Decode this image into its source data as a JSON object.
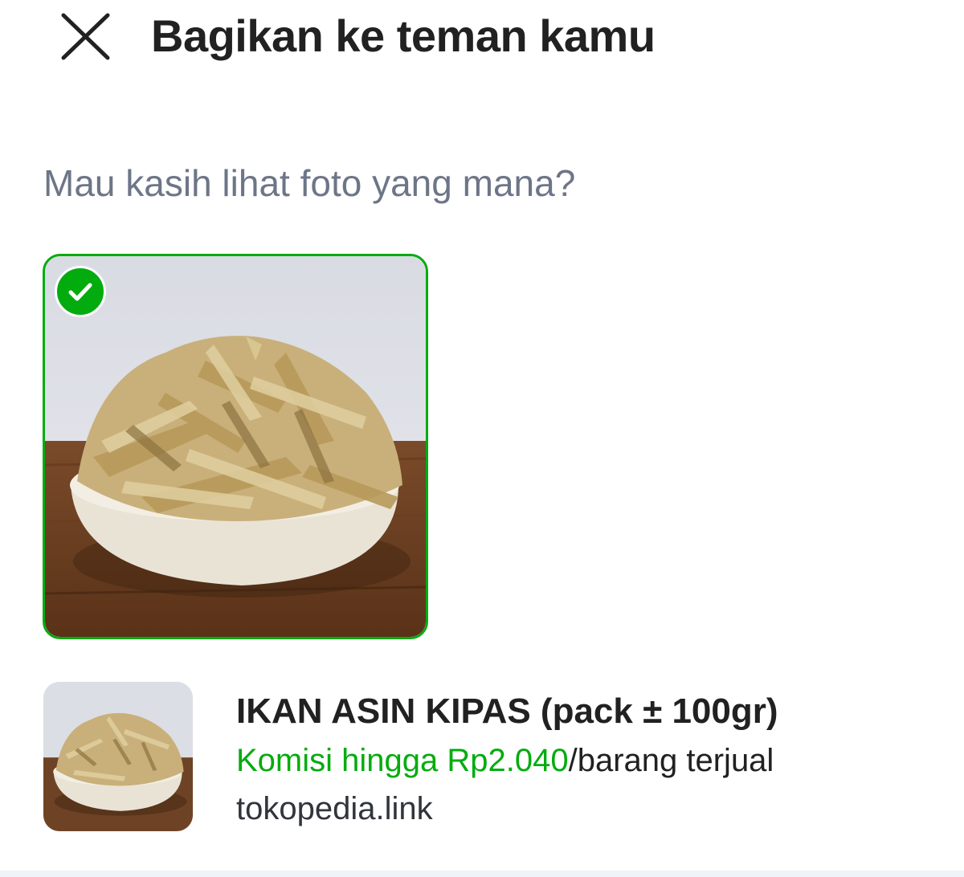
{
  "header": {
    "title": "Bagikan ke teman kamu",
    "close_icon": "close-icon"
  },
  "prompt": "Mau kasih lihat foto yang mana?",
  "photos": [
    {
      "selected": true,
      "check_icon": "check-icon",
      "selected_color": "#03ac0e"
    }
  ],
  "product": {
    "name": "IKAN ASIN KIPAS (pack ± 100gr)",
    "commission_highlight": "Komisi hingga Rp2.040",
    "commission_suffix": "/barang terjual",
    "link": "tokopedia.link"
  },
  "colors": {
    "accent": "#03ac0e",
    "text_primary": "#212121",
    "text_secondary": "#6d7588"
  }
}
